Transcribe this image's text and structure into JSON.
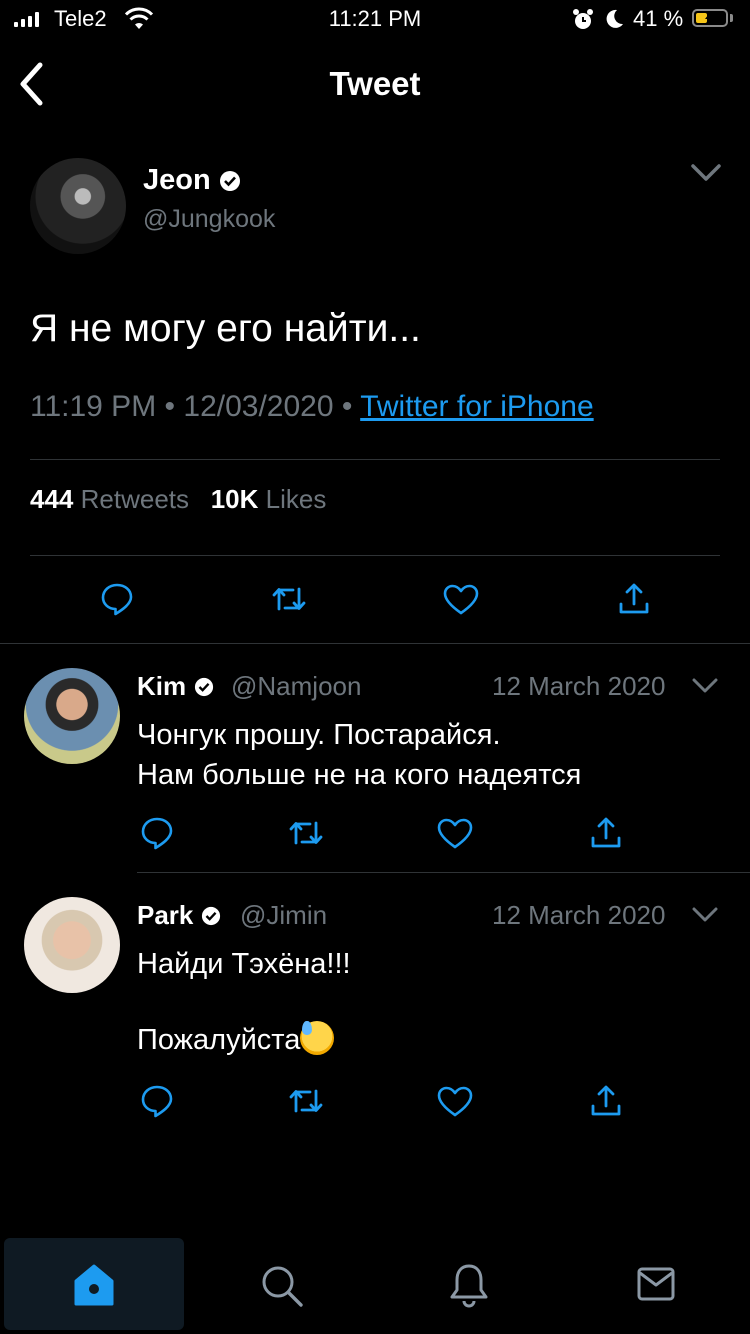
{
  "status_bar": {
    "carrier": "Tele2",
    "time": "11:21 PM",
    "battery_percent": "41 %",
    "battery_level": 0.41,
    "icons": [
      "signal-icon",
      "wifi-icon",
      "alarm-icon",
      "moon-icon",
      "battery-charging-icon"
    ]
  },
  "header": {
    "title": "Tweet",
    "back_icon": "chevron-left-icon"
  },
  "tweet": {
    "author_name": "Jeon",
    "author_handle": "@Jungkook",
    "text": "Я не могу его найти...",
    "time": "11:19 PM",
    "sep": "•",
    "date": "12/03/2020",
    "source": "Twitter for iPhone",
    "retweets_count": "444",
    "retweets_label": "Retweets",
    "likes_count": "10K",
    "likes_label": "Likes"
  },
  "replies": [
    {
      "name": "Kim",
      "handle": "@Namjoon",
      "date": "12 March 2020",
      "lines": [
        "Чонгук прошу. Постарайся.",
        "Нам больше не на кого надеятся"
      ]
    },
    {
      "name": "Park",
      "handle": "@Jimin",
      "date": "12 March 2020",
      "lines": [
        "Найди Тэхёна!!!",
        "Пожалуйста"
      ]
    }
  ],
  "tab_bar": {
    "items": [
      "home",
      "search",
      "notifications",
      "messages"
    ],
    "active": "home"
  },
  "colors": {
    "accent": "#1d9bf0",
    "muted": "#6e767d",
    "divider": "#2f3336"
  }
}
